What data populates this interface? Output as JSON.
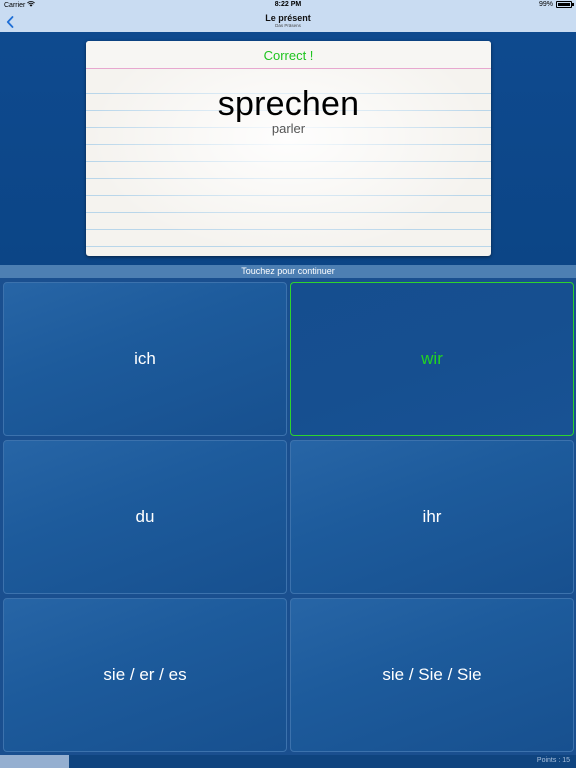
{
  "status_bar": {
    "carrier": "Carrier",
    "time": "8:22 PM",
    "battery": "99%",
    "battery_level": 0.99
  },
  "nav": {
    "title": "Le présent",
    "subtitle": "Das Präsens"
  },
  "card": {
    "feedback": "Correct !",
    "verb": "sprechen",
    "translation": "parler"
  },
  "instruction": "Touchez pour continuer",
  "answers": [
    {
      "label": "ich",
      "state": "normal"
    },
    {
      "label": "wir",
      "state": "correct"
    },
    {
      "label": "du",
      "state": "normal"
    },
    {
      "label": "ihr",
      "state": "normal"
    },
    {
      "label": "sie / er / es",
      "state": "normal"
    },
    {
      "label": "sie / Sie / Sie",
      "state": "normal"
    }
  ],
  "footer": {
    "points_label": "Points : 15",
    "progress": 0.12
  },
  "colors": {
    "correct_green": "#22d422",
    "background_blue": "#0e4a8c",
    "nav_bar": "#c9dcf2"
  }
}
